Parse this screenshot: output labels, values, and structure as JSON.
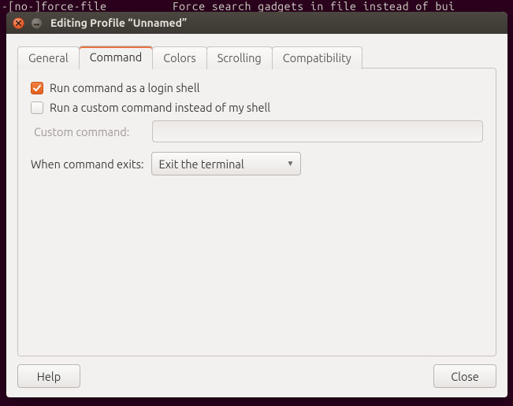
{
  "bg_terminal": "-[no-]force-file          Force search gadgets in file instead of bui",
  "window": {
    "title": "Editing Profile “Unnamed”"
  },
  "tabs": [
    {
      "label": "General"
    },
    {
      "label": "Command"
    },
    {
      "label": "Colors"
    },
    {
      "label": "Scrolling"
    },
    {
      "label": "Compatibility"
    }
  ],
  "active_tab": 1,
  "command_panel": {
    "login_shell_label": "Run command as a login shell",
    "login_shell_checked": true,
    "custom_cmd_label": "Run a custom command instead of my shell",
    "custom_cmd_checked": false,
    "custom_cmd_field_label": "Custom command:",
    "custom_cmd_value": "",
    "exit_label": "When command exits:",
    "exit_value": "Exit the terminal"
  },
  "footer": {
    "help": "Help",
    "close": "Close"
  }
}
